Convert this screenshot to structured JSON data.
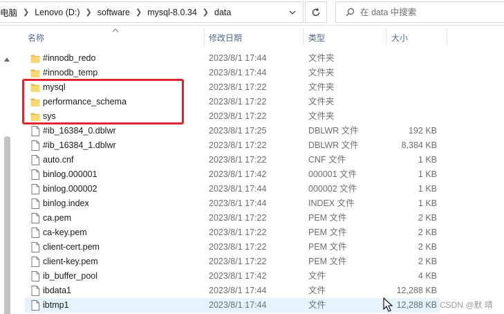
{
  "address_bar": {
    "crumbs": [
      "电脑",
      "Lenovo (D:)",
      "software",
      "mysql-8.0.34",
      "data"
    ]
  },
  "search": {
    "placeholder": "在 data 中搜索"
  },
  "columns": {
    "name": "名称",
    "date": "修改日期",
    "type": "类型",
    "size": "大小"
  },
  "files": [
    {
      "name": "#innodb_redo",
      "date": "2023/8/1 17:44",
      "type": "文件夹",
      "size": "",
      "kind": "folder"
    },
    {
      "name": "#innodb_temp",
      "date": "2023/8/1 17:44",
      "type": "文件夹",
      "size": "",
      "kind": "folder"
    },
    {
      "name": "mysql",
      "date": "2023/8/1 17:22",
      "type": "文件夹",
      "size": "",
      "kind": "folder"
    },
    {
      "name": "performance_schema",
      "date": "2023/8/1 17:22",
      "type": "文件夹",
      "size": "",
      "kind": "folder"
    },
    {
      "name": "sys",
      "date": "2023/8/1 17:22",
      "type": "文件夹",
      "size": "",
      "kind": "folder"
    },
    {
      "name": "#ib_16384_0.dblwr",
      "date": "2023/8/1 17:25",
      "type": "DBLWR 文件",
      "size": "192 KB",
      "kind": "file"
    },
    {
      "name": "#ib_16384_1.dblwr",
      "date": "2023/8/1 17:22",
      "type": "DBLWR 文件",
      "size": "8,384 KB",
      "kind": "file"
    },
    {
      "name": "auto.cnf",
      "date": "2023/8/1 17:22",
      "type": "CNF 文件",
      "size": "1 KB",
      "kind": "file"
    },
    {
      "name": "binlog.000001",
      "date": "2023/8/1 17:42",
      "type": "000001 文件",
      "size": "1 KB",
      "kind": "file"
    },
    {
      "name": "binlog.000002",
      "date": "2023/8/1 17:44",
      "type": "000002 文件",
      "size": "1 KB",
      "kind": "file"
    },
    {
      "name": "binlog.index",
      "date": "2023/8/1 17:44",
      "type": "INDEX 文件",
      "size": "1 KB",
      "kind": "file"
    },
    {
      "name": "ca.pem",
      "date": "2023/8/1 17:22",
      "type": "PEM 文件",
      "size": "2 KB",
      "kind": "file"
    },
    {
      "name": "ca-key.pem",
      "date": "2023/8/1 17:22",
      "type": "PEM 文件",
      "size": "2 KB",
      "kind": "file"
    },
    {
      "name": "client-cert.pem",
      "date": "2023/8/1 17:22",
      "type": "PEM 文件",
      "size": "2 KB",
      "kind": "file"
    },
    {
      "name": "client-key.pem",
      "date": "2023/8/1 17:22",
      "type": "PEM 文件",
      "size": "2 KB",
      "kind": "file"
    },
    {
      "name": "ib_buffer_pool",
      "date": "2023/8/1 17:42",
      "type": "文件",
      "size": "4 KB",
      "kind": "file"
    },
    {
      "name": "ibdata1",
      "date": "2023/8/1 17:44",
      "type": "文件",
      "size": "12,288 KB",
      "kind": "file"
    },
    {
      "name": "ibtmp1",
      "date": "2023/8/1 17:44",
      "type": "文件",
      "size": "12,288 KB",
      "kind": "file",
      "selected": true
    }
  ],
  "watermark": "CSDN @默 晴",
  "colors": {
    "folder": "#f8d775",
    "folder_dark": "#e8b84a",
    "highlight": "#e0242c",
    "header_text": "#4d6a8f",
    "selected_row": "#e5f3ff"
  },
  "icons": {
    "folder": "folder-icon",
    "file": "file-icon",
    "refresh": "refresh-icon",
    "search": "search-icon",
    "chevron": "chevron-down-icon",
    "sort": "sort-up-icon"
  }
}
